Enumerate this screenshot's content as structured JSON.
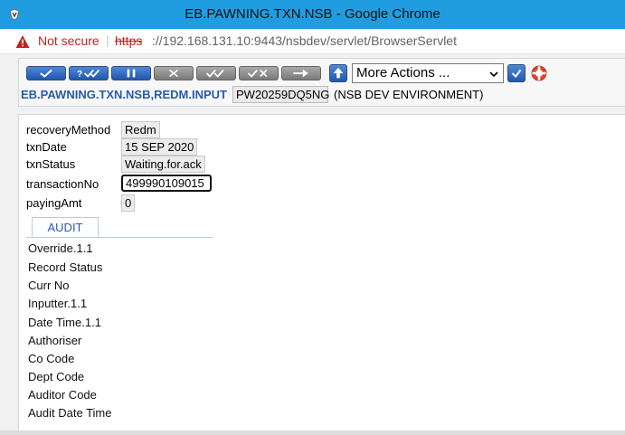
{
  "window": {
    "title": "EB.PAWNING.TXN.NSB - Google Chrome"
  },
  "address_bar": {
    "security_label": "Not secure",
    "scheme": "https",
    "url_rest": "://192.168.131.10:9443/nsbdev/servlet/BrowserServlet"
  },
  "toolbar": {
    "actions_select": {
      "selected": "More Actions ..."
    }
  },
  "header": {
    "app_id": "EB.PAWNING.TXN.NSB,REDM.INPUT",
    "record_id": "PW20259DQ5NG",
    "environment": "(NSB DEV ENVIRONMENT)"
  },
  "fields": [
    {
      "label": "recoveryMethod",
      "value": "Redm"
    },
    {
      "label": "txnDate",
      "value": "15 SEP 2020"
    },
    {
      "label": "txnStatus",
      "value": "Waiting.for.ack"
    },
    {
      "label": "transactionNo",
      "value": "499990109015"
    },
    {
      "label": "payingAmt",
      "value": "0"
    }
  ],
  "audit_tab": {
    "label": "AUDIT",
    "items": [
      "Override.1.1",
      "Record Status",
      "Curr No",
      "Inputter.1.1",
      "Date Time.1.1",
      "Authoriser",
      "Co Code",
      "Dept Code",
      "Auditor Code",
      "Audit Date Time"
    ]
  },
  "colors": {
    "titlebar": "#1f9de0",
    "not_secure": "#c5221f",
    "accent": "#2a5aa8"
  }
}
